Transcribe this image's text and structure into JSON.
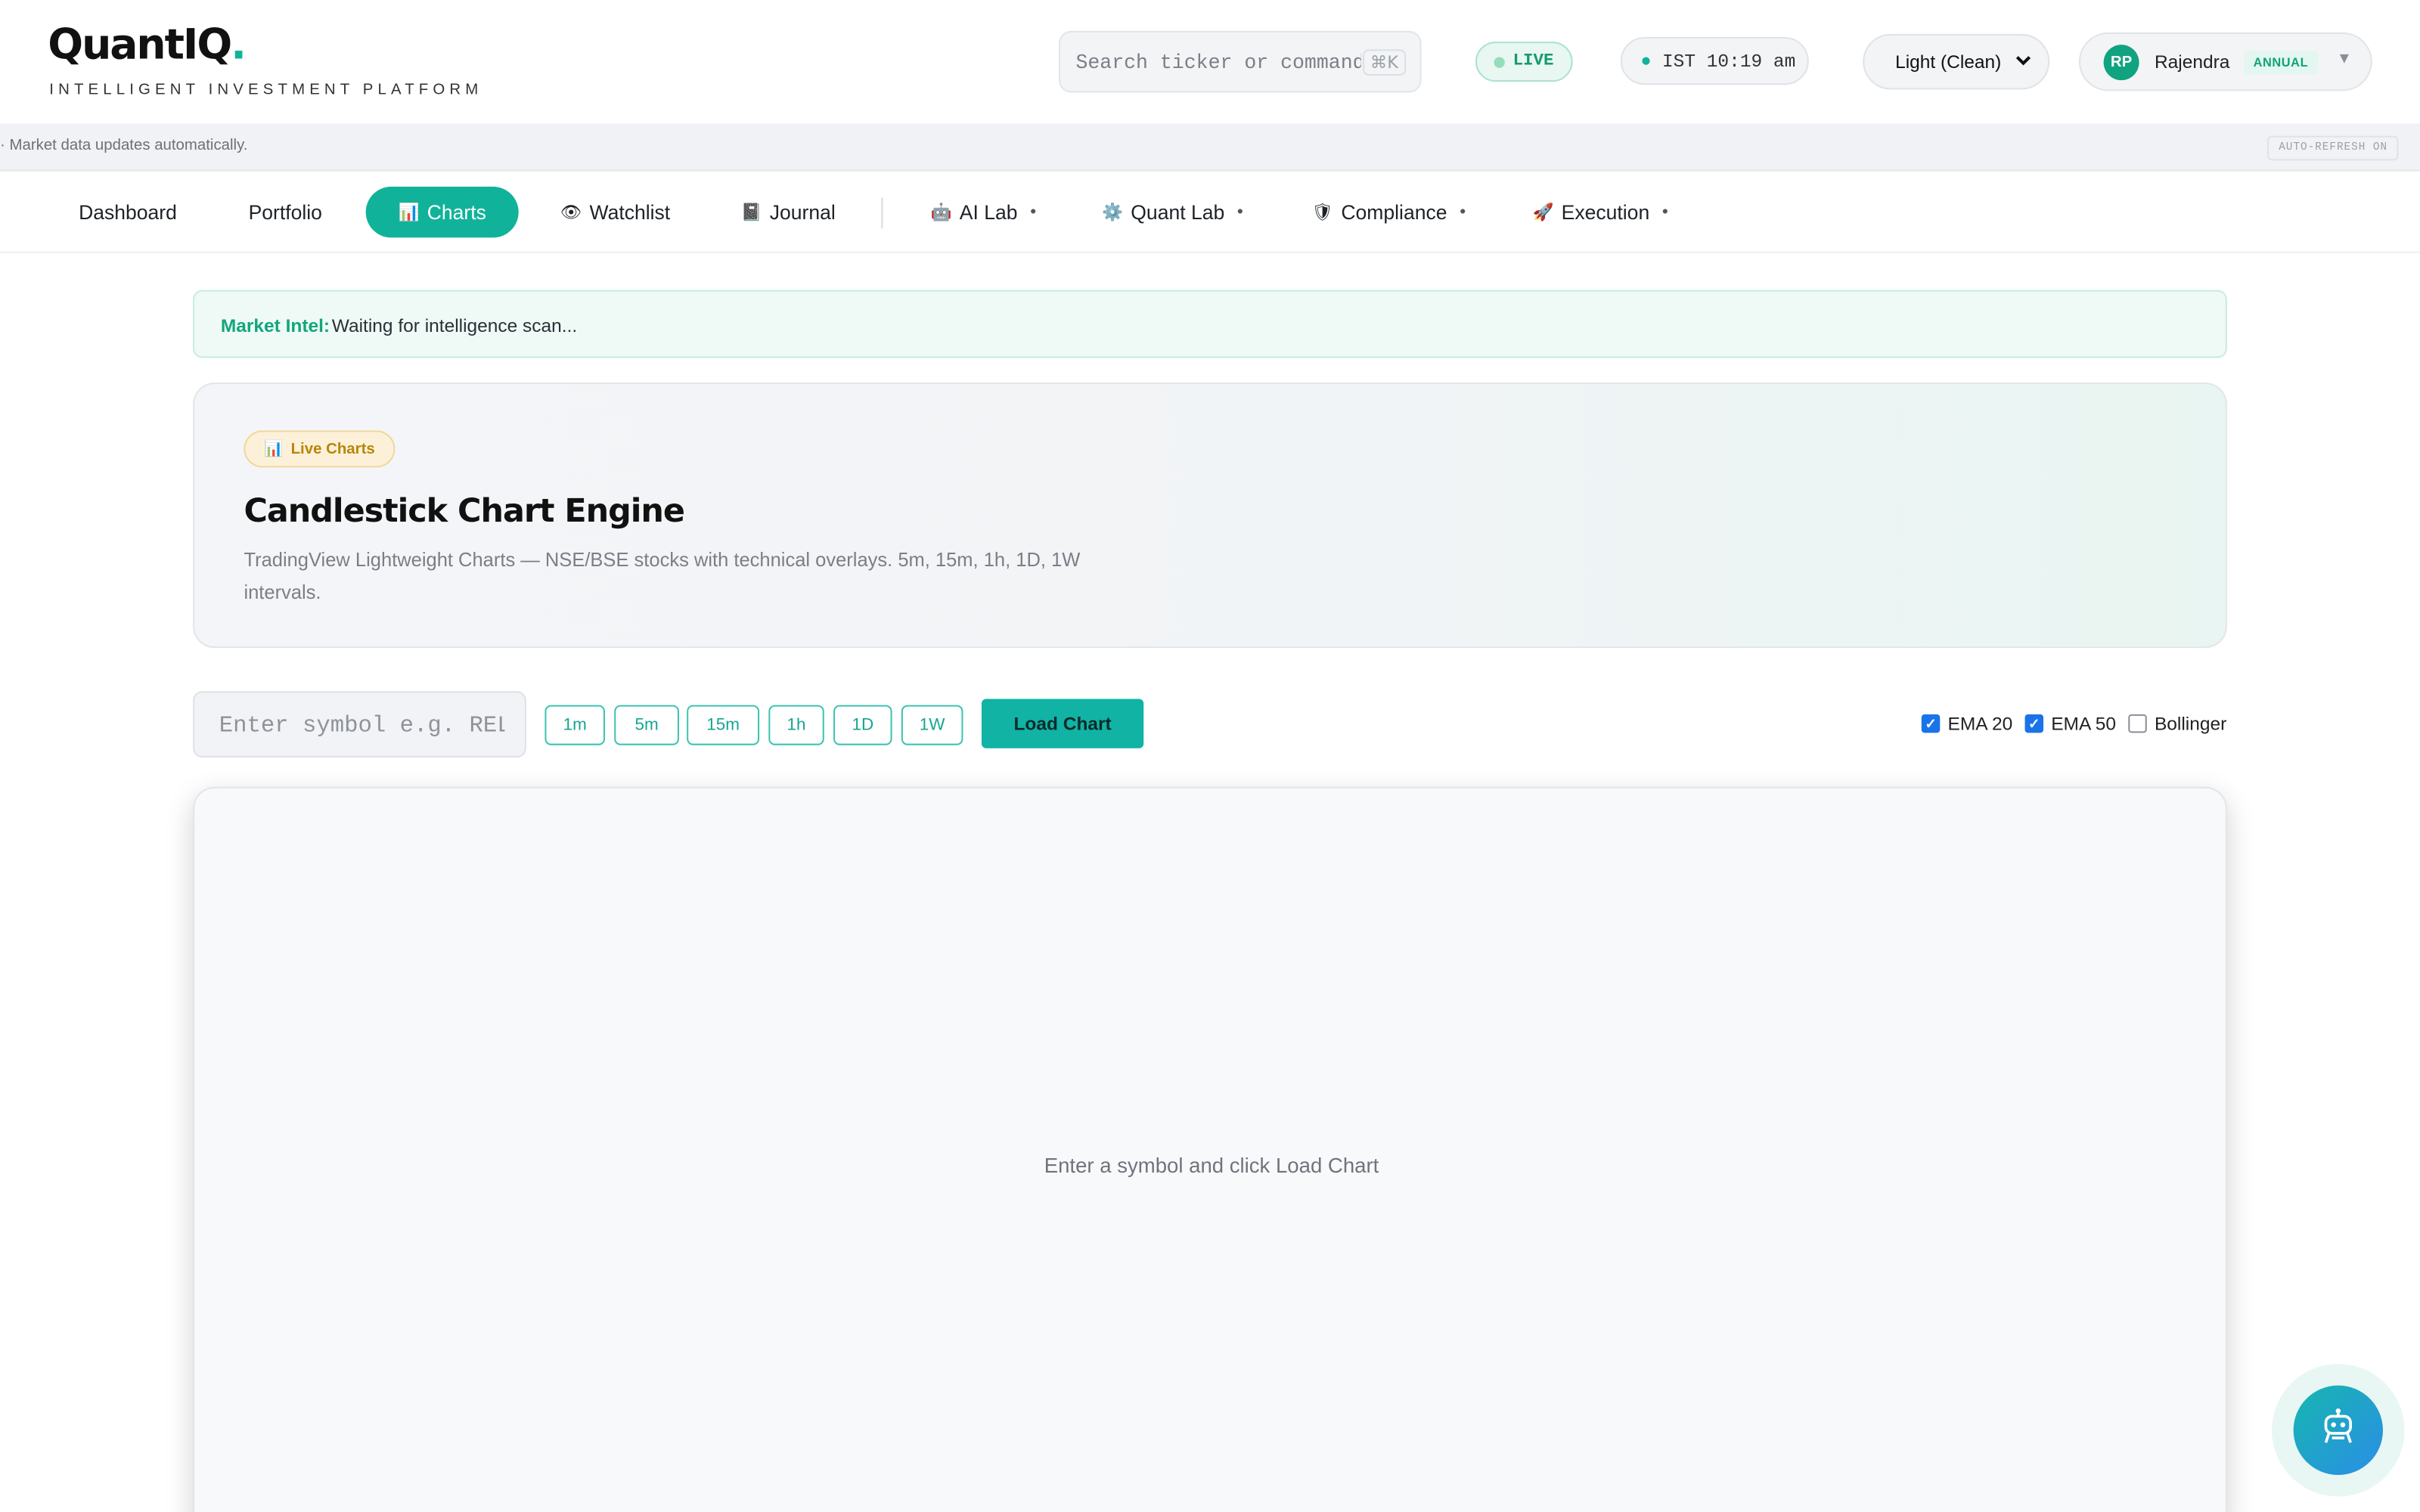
{
  "header": {
    "logo_text": "QuantIQ",
    "logo_dot": ".",
    "tagline": "INTELLIGENT INVESTMENT PLATFORM",
    "search_placeholder": "Search ticker or command...",
    "search_shortcut": "⌘K",
    "live_label": "LIVE",
    "clock": "IST 10:19 am",
    "theme_selected": "Light (Clean)",
    "user_initials": "RP",
    "user_name": "Rajendra",
    "plan": "ANNUAL"
  },
  "infobar": {
    "message": "· Market data updates automatically.",
    "auto_refresh": "AUTO-REFRESH ON"
  },
  "nav": {
    "items": [
      {
        "label": "Dashboard",
        "icon": ""
      },
      {
        "label": "Portfolio",
        "icon": ""
      },
      {
        "label": "Charts",
        "icon": "📊"
      },
      {
        "label": "Watchlist",
        "icon": "👁"
      },
      {
        "label": "Journal",
        "icon": "📓"
      },
      {
        "label": "AI Lab",
        "icon": "🤖"
      },
      {
        "label": "Quant Lab",
        "icon": "⚙️"
      },
      {
        "label": "Compliance",
        "icon": "🛡"
      },
      {
        "label": "Execution",
        "icon": "🚀"
      }
    ],
    "active": "Charts"
  },
  "intel": {
    "label": "Market Intel:",
    "text": "Waiting for intelligence scan..."
  },
  "hero": {
    "badge_icon": "📊",
    "badge": "Live Charts",
    "title": "Candlestick Chart Engine",
    "description": "TradingView Lightweight Charts — NSE/BSE stocks with technical overlays. 5m, 15m, 1h, 1D, 1W intervals."
  },
  "controls": {
    "symbol_placeholder": "Enter symbol e.g. RELIANCE",
    "intervals": [
      "1m",
      "5m",
      "15m",
      "1h",
      "1D",
      "1W"
    ],
    "load_button": "Load Chart",
    "overlays": [
      {
        "label": "EMA 20",
        "checked": true
      },
      {
        "label": "EMA 50",
        "checked": true
      },
      {
        "label": "Bollinger",
        "checked": false
      }
    ]
  },
  "chart_panel": {
    "empty_message": "Enter a symbol and click Load Chart"
  },
  "colors": {
    "accent": "#10b39a",
    "active_nav": "#10b39a",
    "load_button": "#10b3a4",
    "checkbox": "#1a73e8"
  }
}
